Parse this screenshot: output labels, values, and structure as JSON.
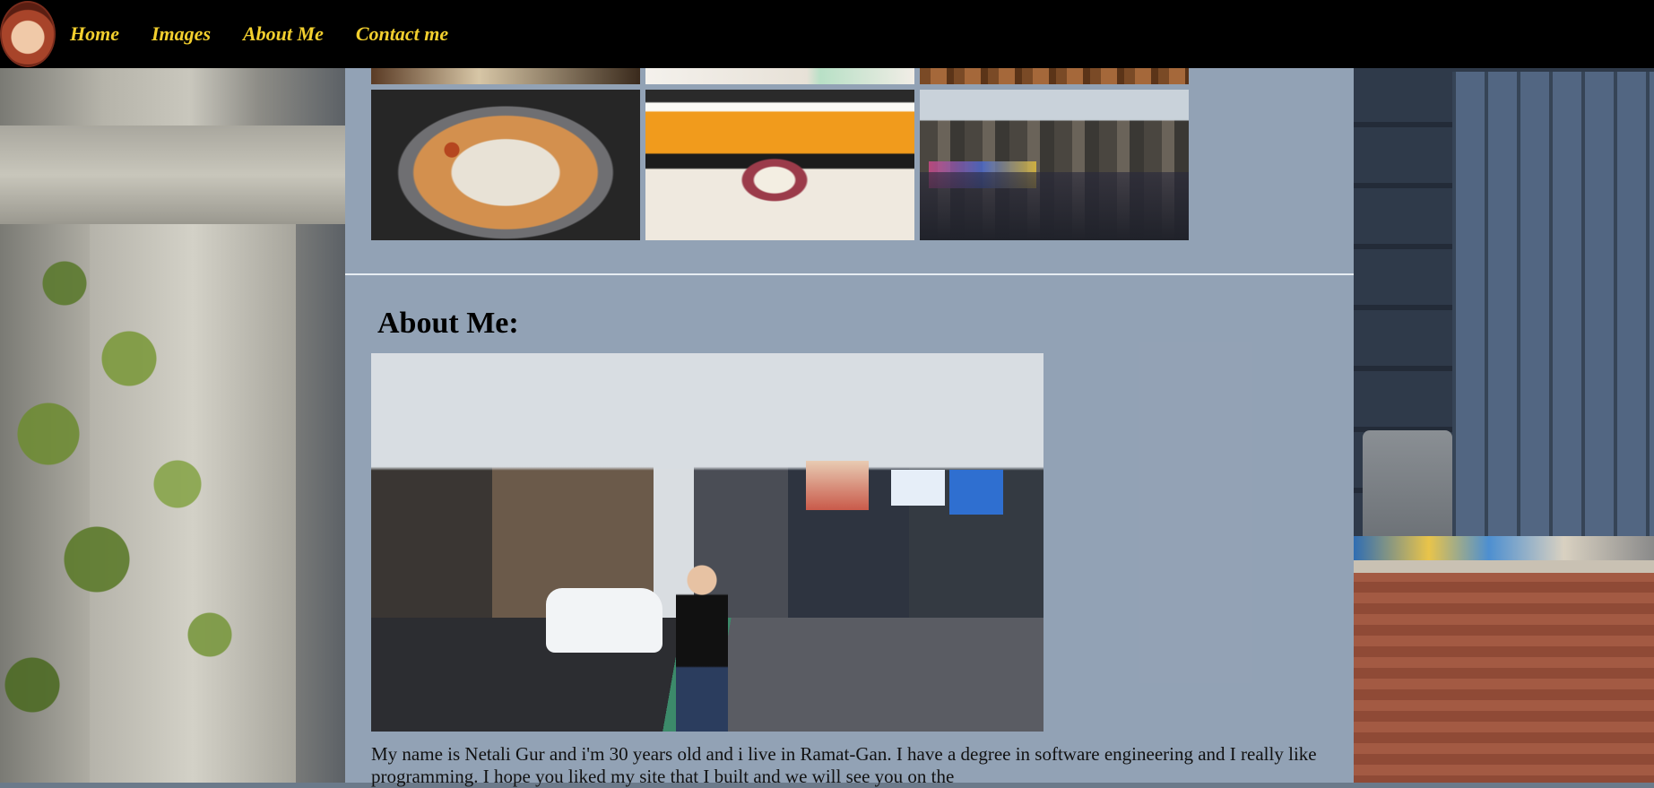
{
  "navbar": {
    "items": [
      {
        "label": "Home"
      },
      {
        "label": "Images"
      },
      {
        "label": "About Me"
      },
      {
        "label": "Contact me"
      }
    ],
    "link_color": "#f2cf2e",
    "background": "#000000"
  },
  "about": {
    "heading": "About Me:",
    "text": "My name is Netali Gur and i'm 30 years old and i live in Ramat-Gan. I have a degree in software engineering and I really like programming. I hope you liked my site that I built and we will see you on the"
  }
}
